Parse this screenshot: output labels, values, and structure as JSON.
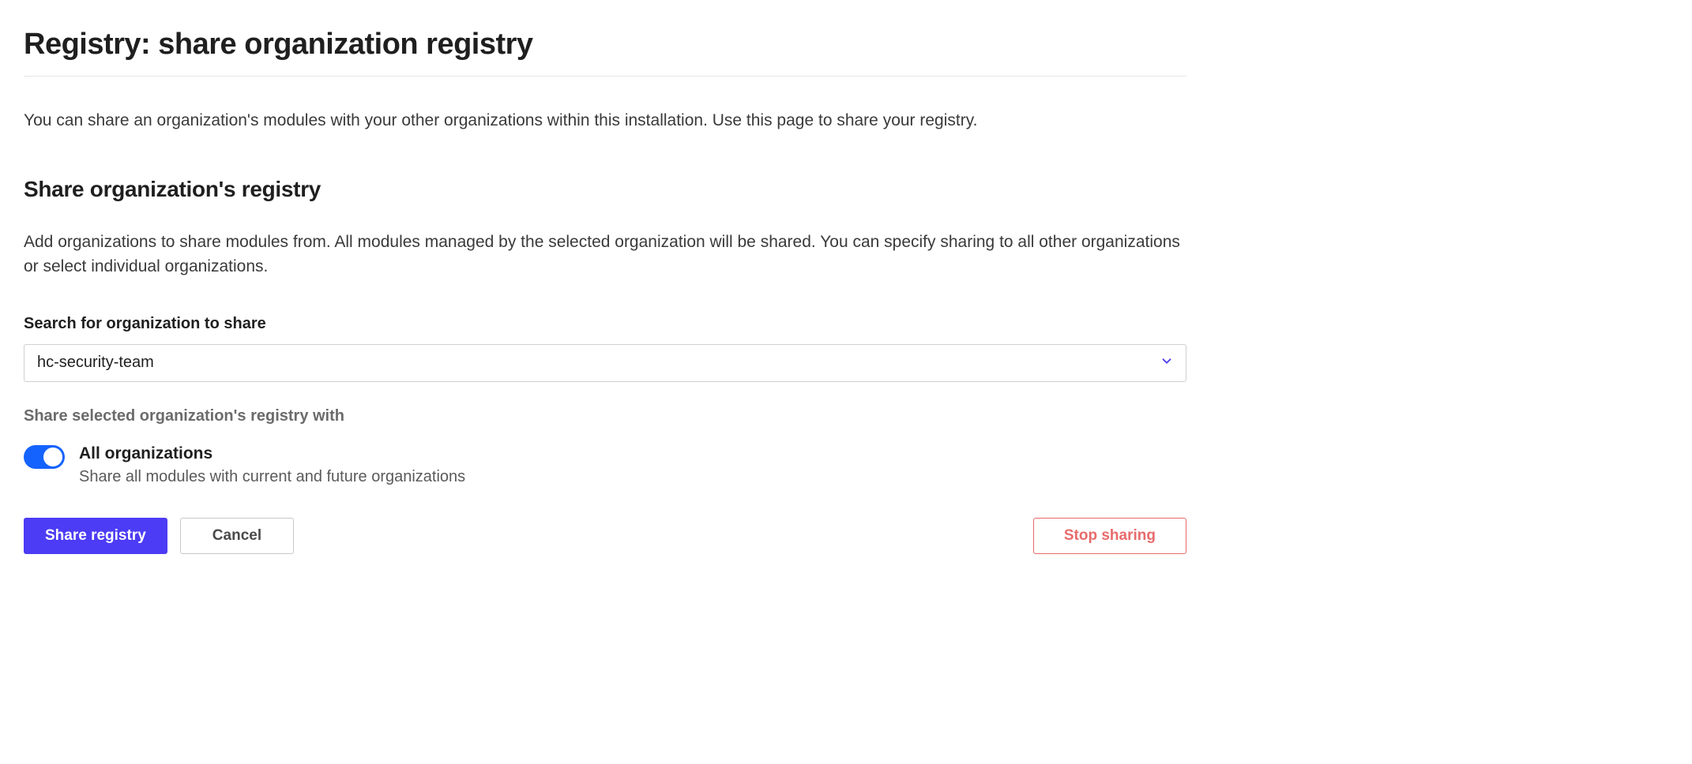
{
  "header": {
    "title": "Registry: share organization registry",
    "description": "You can share an organization's modules with your other organizations within this installation. Use this page to share your registry."
  },
  "section": {
    "title": "Share organization's registry",
    "description": "Add organizations to share modules from. All modules managed by the selected organization will be shared. You can specify sharing to all other organizations or select individual organizations."
  },
  "search": {
    "label": "Search for organization to share",
    "value": "hc-security-team"
  },
  "shareWith": {
    "label": "Share selected organization's registry with",
    "toggle": {
      "enabled": true,
      "title": "All organizations",
      "description": "Share all modules with current and future organizations"
    }
  },
  "buttons": {
    "share": "Share registry",
    "cancel": "Cancel",
    "stop": "Stop sharing"
  },
  "colors": {
    "primary": "#4c3cf5",
    "toggle": "#1563ff",
    "danger": "#e86b6b"
  }
}
